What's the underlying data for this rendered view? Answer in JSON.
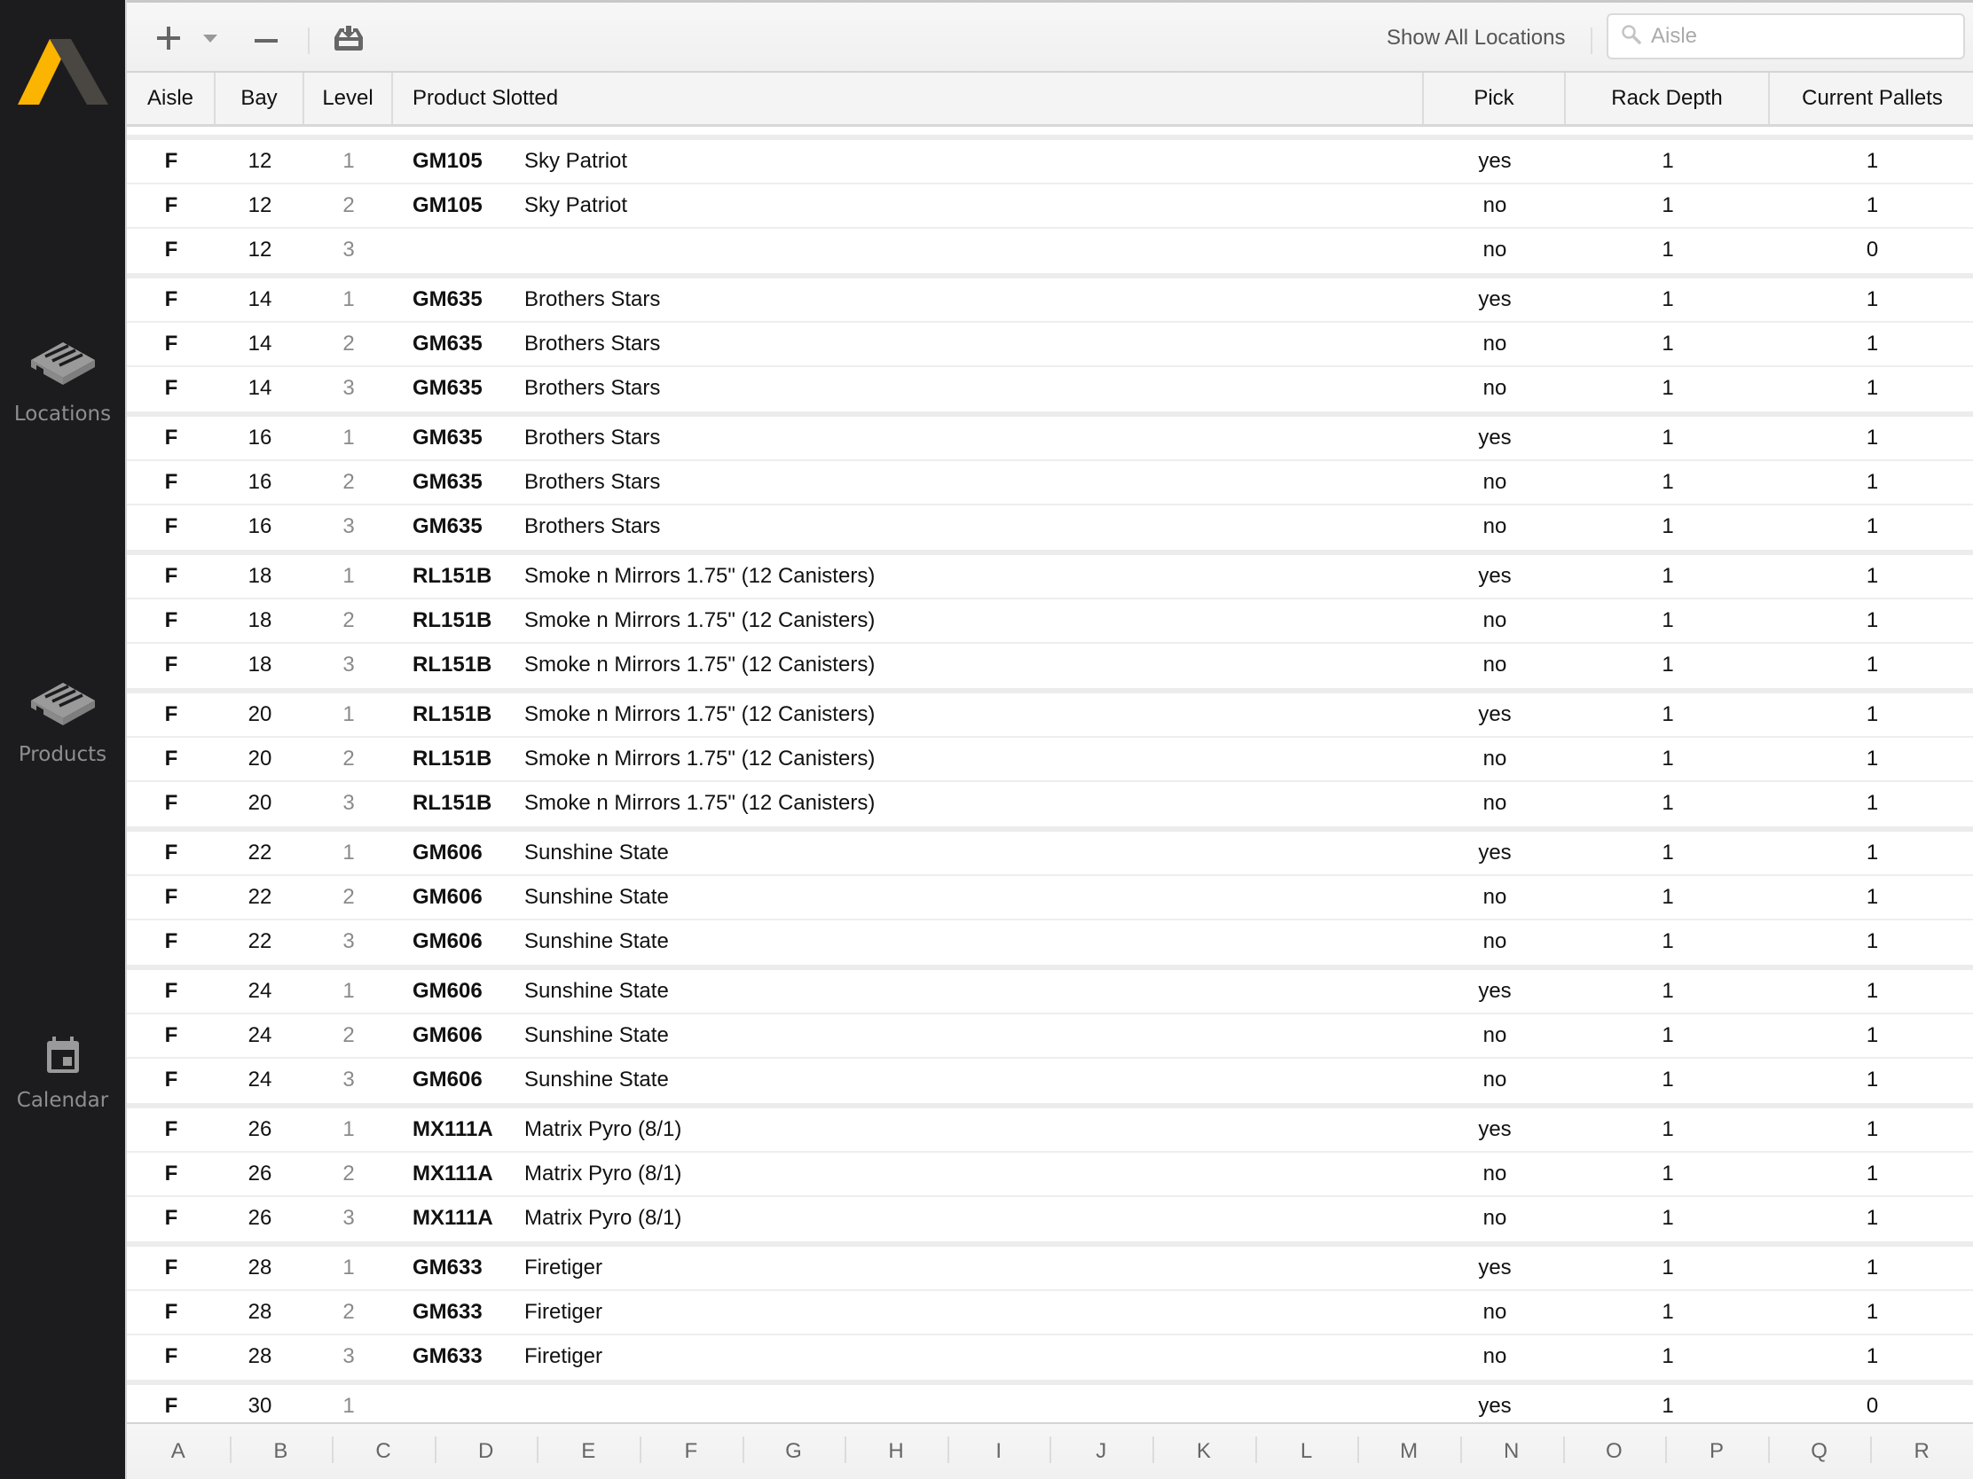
{
  "sidebar": {
    "logo": "app-logo",
    "items": [
      {
        "label": "Locations",
        "icon": "pallet-icon"
      },
      {
        "label": "Products",
        "icon": "pallet-icon"
      },
      {
        "label": "Calendar",
        "icon": "calendar-icon"
      }
    ]
  },
  "toolbar": {
    "add_icon": "plus-icon",
    "add_menu_icon": "caret-down-icon",
    "remove_icon": "minus-icon",
    "export_icon": "tray-download-icon",
    "show_all_label": "Show All Locations",
    "search": {
      "placeholder": "Aisle",
      "value": "",
      "icon": "search-icon"
    }
  },
  "table": {
    "columns": [
      "Aisle",
      "Bay",
      "Level",
      "Product Slotted",
      "Pick",
      "Rack Depth",
      "Current Pallets"
    ],
    "groups": [
      {
        "rows": [
          {
            "aisle": "F",
            "bay": "12",
            "level": "1",
            "sku": "GM105",
            "name": "Sky Patriot",
            "pick": "yes",
            "rack_depth": "1",
            "pallets": "1"
          },
          {
            "aisle": "F",
            "bay": "12",
            "level": "2",
            "sku": "GM105",
            "name": "Sky Patriot",
            "pick": "no",
            "rack_depth": "1",
            "pallets": "1"
          },
          {
            "aisle": "F",
            "bay": "12",
            "level": "3",
            "sku": "",
            "name": "",
            "pick": "no",
            "rack_depth": "1",
            "pallets": "0"
          }
        ]
      },
      {
        "rows": [
          {
            "aisle": "F",
            "bay": "14",
            "level": "1",
            "sku": "GM635",
            "name": "Brothers Stars",
            "pick": "yes",
            "rack_depth": "1",
            "pallets": "1"
          },
          {
            "aisle": "F",
            "bay": "14",
            "level": "2",
            "sku": "GM635",
            "name": "Brothers Stars",
            "pick": "no",
            "rack_depth": "1",
            "pallets": "1"
          },
          {
            "aisle": "F",
            "bay": "14",
            "level": "3",
            "sku": "GM635",
            "name": "Brothers Stars",
            "pick": "no",
            "rack_depth": "1",
            "pallets": "1"
          }
        ]
      },
      {
        "rows": [
          {
            "aisle": "F",
            "bay": "16",
            "level": "1",
            "sku": "GM635",
            "name": "Brothers Stars",
            "pick": "yes",
            "rack_depth": "1",
            "pallets": "1"
          },
          {
            "aisle": "F",
            "bay": "16",
            "level": "2",
            "sku": "GM635",
            "name": "Brothers Stars",
            "pick": "no",
            "rack_depth": "1",
            "pallets": "1"
          },
          {
            "aisle": "F",
            "bay": "16",
            "level": "3",
            "sku": "GM635",
            "name": "Brothers Stars",
            "pick": "no",
            "rack_depth": "1",
            "pallets": "1"
          }
        ]
      },
      {
        "rows": [
          {
            "aisle": "F",
            "bay": "18",
            "level": "1",
            "sku": "RL151B",
            "name": "Smoke n Mirrors 1.75\" (12 Canisters)",
            "pick": "yes",
            "rack_depth": "1",
            "pallets": "1"
          },
          {
            "aisle": "F",
            "bay": "18",
            "level": "2",
            "sku": "RL151B",
            "name": "Smoke n Mirrors 1.75\" (12 Canisters)",
            "pick": "no",
            "rack_depth": "1",
            "pallets": "1"
          },
          {
            "aisle": "F",
            "bay": "18",
            "level": "3",
            "sku": "RL151B",
            "name": "Smoke n Mirrors 1.75\" (12 Canisters)",
            "pick": "no",
            "rack_depth": "1",
            "pallets": "1"
          }
        ]
      },
      {
        "rows": [
          {
            "aisle": "F",
            "bay": "20",
            "level": "1",
            "sku": "RL151B",
            "name": "Smoke n Mirrors 1.75\" (12 Canisters)",
            "pick": "yes",
            "rack_depth": "1",
            "pallets": "1"
          },
          {
            "aisle": "F",
            "bay": "20",
            "level": "2",
            "sku": "RL151B",
            "name": "Smoke n Mirrors 1.75\" (12 Canisters)",
            "pick": "no",
            "rack_depth": "1",
            "pallets": "1"
          },
          {
            "aisle": "F",
            "bay": "20",
            "level": "3",
            "sku": "RL151B",
            "name": "Smoke n Mirrors 1.75\" (12 Canisters)",
            "pick": "no",
            "rack_depth": "1",
            "pallets": "1"
          }
        ]
      },
      {
        "rows": [
          {
            "aisle": "F",
            "bay": "22",
            "level": "1",
            "sku": "GM606",
            "name": "Sunshine State",
            "pick": "yes",
            "rack_depth": "1",
            "pallets": "1"
          },
          {
            "aisle": "F",
            "bay": "22",
            "level": "2",
            "sku": "GM606",
            "name": "Sunshine State",
            "pick": "no",
            "rack_depth": "1",
            "pallets": "1"
          },
          {
            "aisle": "F",
            "bay": "22",
            "level": "3",
            "sku": "GM606",
            "name": "Sunshine State",
            "pick": "no",
            "rack_depth": "1",
            "pallets": "1"
          }
        ]
      },
      {
        "rows": [
          {
            "aisle": "F",
            "bay": "24",
            "level": "1",
            "sku": "GM606",
            "name": "Sunshine State",
            "pick": "yes",
            "rack_depth": "1",
            "pallets": "1"
          },
          {
            "aisle": "F",
            "bay": "24",
            "level": "2",
            "sku": "GM606",
            "name": "Sunshine State",
            "pick": "no",
            "rack_depth": "1",
            "pallets": "1"
          },
          {
            "aisle": "F",
            "bay": "24",
            "level": "3",
            "sku": "GM606",
            "name": "Sunshine State",
            "pick": "no",
            "rack_depth": "1",
            "pallets": "1"
          }
        ]
      },
      {
        "rows": [
          {
            "aisle": "F",
            "bay": "26",
            "level": "1",
            "sku": "MX111A",
            "name": "Matrix Pyro (8/1)",
            "pick": "yes",
            "rack_depth": "1",
            "pallets": "1"
          },
          {
            "aisle": "F",
            "bay": "26",
            "level": "2",
            "sku": "MX111A",
            "name": "Matrix Pyro (8/1)",
            "pick": "no",
            "rack_depth": "1",
            "pallets": "1"
          },
          {
            "aisle": "F",
            "bay": "26",
            "level": "3",
            "sku": "MX111A",
            "name": "Matrix Pyro (8/1)",
            "pick": "no",
            "rack_depth": "1",
            "pallets": "1"
          }
        ]
      },
      {
        "rows": [
          {
            "aisle": "F",
            "bay": "28",
            "level": "1",
            "sku": "GM633",
            "name": "Firetiger",
            "pick": "yes",
            "rack_depth": "1",
            "pallets": "1"
          },
          {
            "aisle": "F",
            "bay": "28",
            "level": "2",
            "sku": "GM633",
            "name": "Firetiger",
            "pick": "no",
            "rack_depth": "1",
            "pallets": "1"
          },
          {
            "aisle": "F",
            "bay": "28",
            "level": "3",
            "sku": "GM633",
            "name": "Firetiger",
            "pick": "no",
            "rack_depth": "1",
            "pallets": "1"
          }
        ]
      },
      {
        "rows": [
          {
            "aisle": "F",
            "bay": "30",
            "level": "1",
            "sku": "",
            "name": "",
            "pick": "yes",
            "rack_depth": "1",
            "pallets": "0"
          }
        ]
      }
    ]
  },
  "alphabet_index": [
    "A",
    "B",
    "C",
    "D",
    "E",
    "F",
    "G",
    "H",
    "I",
    "J",
    "K",
    "L",
    "M",
    "N",
    "O",
    "P",
    "Q",
    "R"
  ],
  "colors": {
    "brand_yellow": "#fbb400",
    "brand_dark": "#4a4642",
    "sidebar_bg": "#1c1c1e"
  }
}
